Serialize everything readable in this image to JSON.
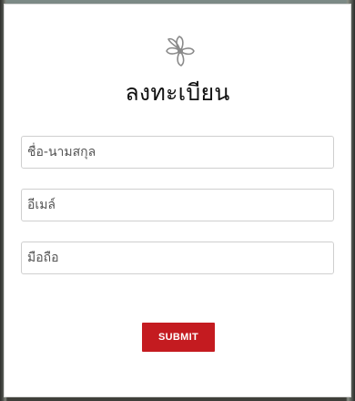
{
  "form": {
    "logo_icon": "flower-logo-icon",
    "title": "ลงทะเบียน",
    "fields": {
      "name": {
        "placeholder": "ชื่อ-นามสกุล",
        "value": ""
      },
      "email": {
        "placeholder": "อีเมล์",
        "value": ""
      },
      "phone": {
        "placeholder": "มือถือ",
        "value": ""
      }
    },
    "submit_label": "SUBMIT"
  },
  "colors": {
    "accent": "#c41b20",
    "border": "#cfcfcf",
    "title": "#111111",
    "placeholder": "#555555"
  }
}
